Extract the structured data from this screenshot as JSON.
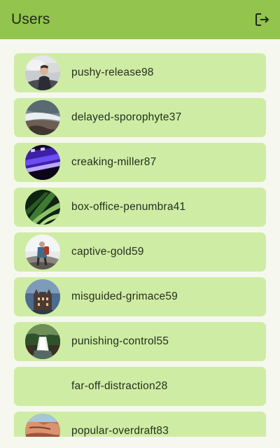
{
  "header": {
    "title": "Users",
    "logout_icon": "logout-icon"
  },
  "users": [
    {
      "username": "pushy-release98",
      "avatar": "photo-person-clouds"
    },
    {
      "username": "delayed-sporophyte37",
      "avatar": "photo-coast-waves"
    },
    {
      "username": "creaking-miller87",
      "avatar": "photo-purple-keyboard"
    },
    {
      "username": "box-office-penumbra41",
      "avatar": "photo-green-leaves"
    },
    {
      "username": "captive-gold59",
      "avatar": "photo-hiker-rocks"
    },
    {
      "username": "misguided-grimace59",
      "avatar": "photo-castle-sunset"
    },
    {
      "username": "punishing-control55",
      "avatar": "photo-forest-waterfall"
    },
    {
      "username": "far-off-distraction28",
      "avatar": ""
    },
    {
      "username": "popular-overdraft83",
      "avatar": "photo-red-rocks"
    }
  ],
  "colors": {
    "app_bar": "#92c44e",
    "item_background": "#cfeca5",
    "page_background": "#f6f8ef"
  }
}
